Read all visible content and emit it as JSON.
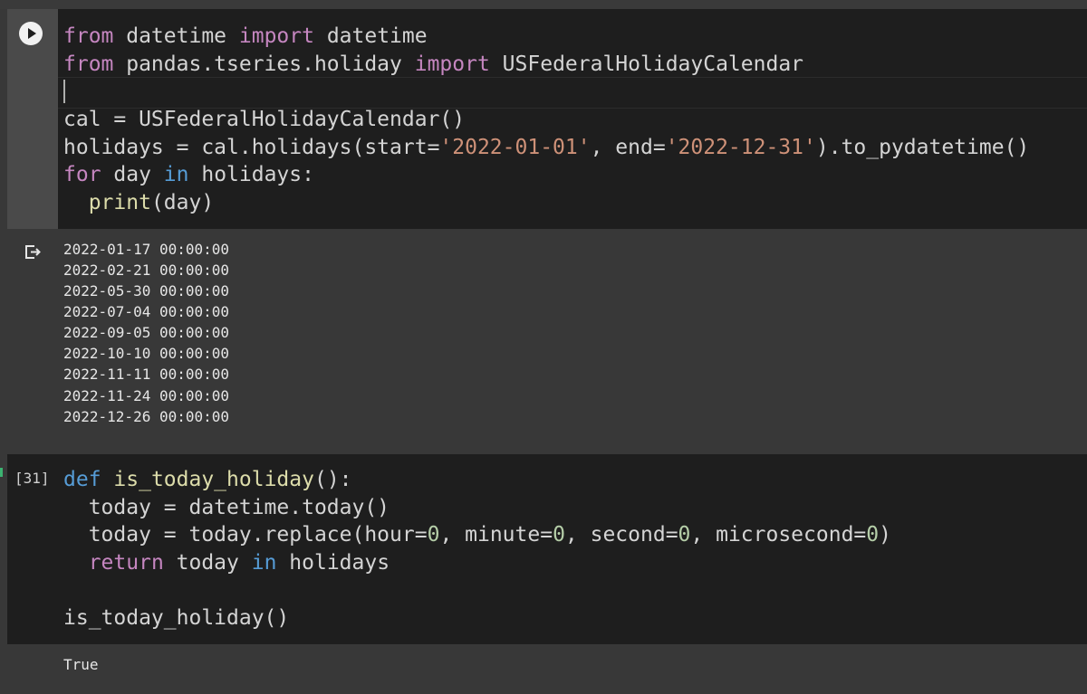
{
  "cell1": {
    "run_button_icon": "play-icon",
    "code_lines": [
      [
        "from",
        " datetime ",
        "import",
        " datetime"
      ],
      [
        "from",
        " pandas.tseries.holiday ",
        "import",
        " USFederalHolidayCalendar"
      ],
      [
        ""
      ],
      [
        "cal = USFederalHolidayCalendar()"
      ],
      [
        "holidays = cal.holidays(start=",
        "'2022-01-01'",
        ", end=",
        "'2022-12-31'",
        ").to_pydatetime()"
      ],
      [
        "for",
        " day ",
        "in",
        " holidays:"
      ],
      [
        "  ",
        "print",
        "(day)"
      ]
    ],
    "output_icon": "output-redirect-icon",
    "output_lines": [
      "2022-01-17 00:00:00",
      "2022-02-21 00:00:00",
      "2022-05-30 00:00:00",
      "2022-07-04 00:00:00",
      "2022-09-05 00:00:00",
      "2022-10-10 00:00:00",
      "2022-11-11 00:00:00",
      "2022-11-24 00:00:00",
      "2022-12-26 00:00:00"
    ]
  },
  "cell2": {
    "execution_count": "[31]",
    "code_lines": [
      [
        "def",
        " ",
        "is_today_holiday",
        "():"
      ],
      [
        "  today = datetime.today()"
      ],
      [
        "  today = today.replace(hour=",
        "0",
        ", minute=",
        "0",
        ", second=",
        "0",
        ", microsecond=",
        "0",
        ")"
      ],
      [
        "  ",
        "return",
        " today ",
        "in",
        " holidays"
      ],
      [
        ""
      ],
      [
        "is_today_holiday()"
      ]
    ],
    "output": "True"
  },
  "colors": {
    "editor_bg": "#1e1e1e",
    "page_bg": "#383838",
    "keyword": "#c586c0",
    "keyword_blue": "#569cd6",
    "string": "#ce9178",
    "number": "#b5cea8",
    "function": "#dcdcaa"
  }
}
